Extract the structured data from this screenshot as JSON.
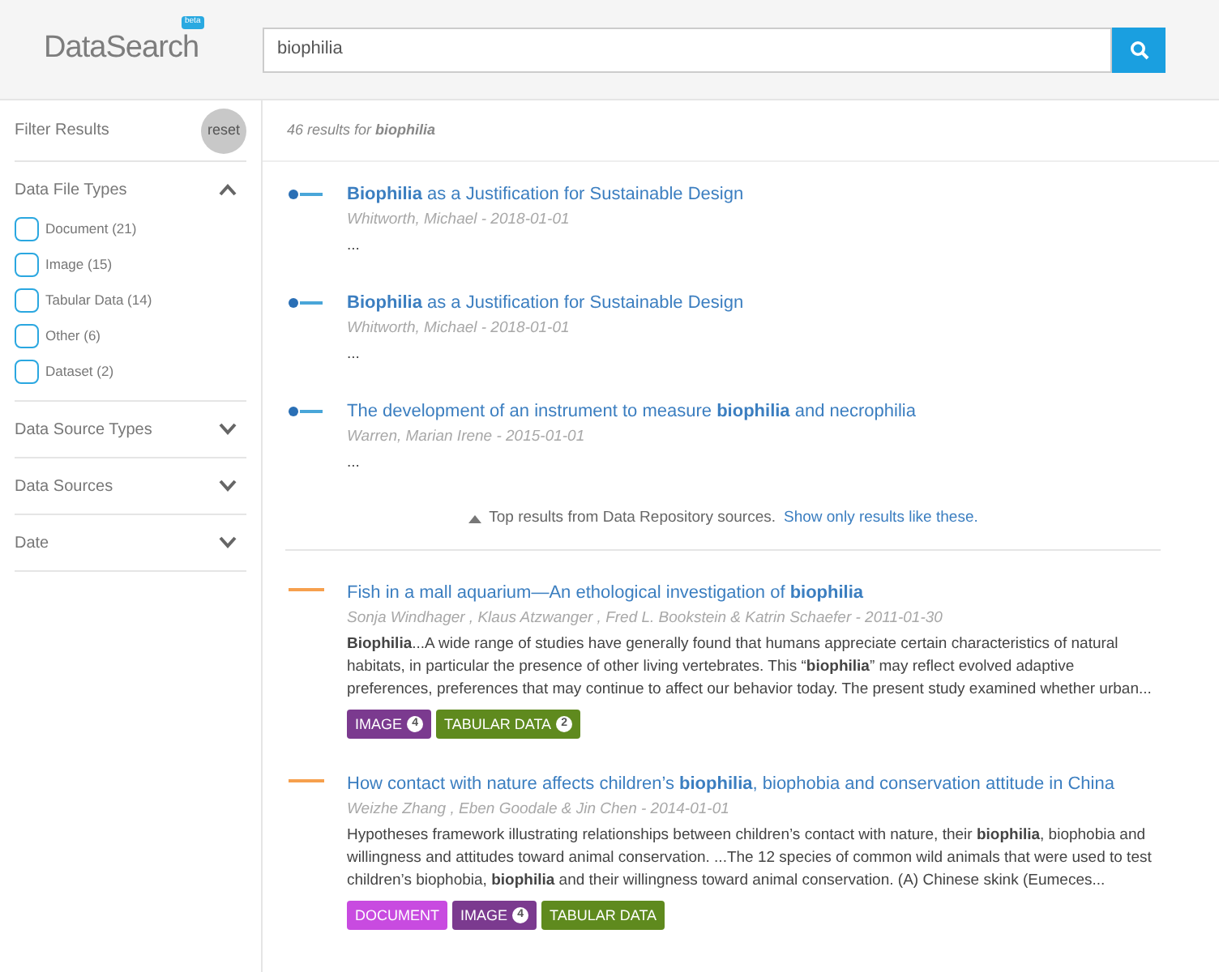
{
  "header": {
    "logo": "DataSearch",
    "logo_badge": "beta",
    "search": {
      "value": "biophilia"
    }
  },
  "sidebar": {
    "title": "Filter Results",
    "reset": "reset",
    "sections": [
      {
        "label": "Data File Types",
        "expanded": true,
        "options": [
          {
            "label": "Document (21)",
            "checked": false
          },
          {
            "label": "Image (15)",
            "checked": false
          },
          {
            "label": "Tabular Data (14)",
            "checked": false
          },
          {
            "label": "Other (6)",
            "checked": false
          },
          {
            "label": "Dataset (2)",
            "checked": false
          }
        ]
      },
      {
        "label": "Data Source Types",
        "expanded": false
      },
      {
        "label": "Data Sources",
        "expanded": false
      },
      {
        "label": "Date",
        "expanded": false
      }
    ]
  },
  "results_summary": "46 results for **biophilia**",
  "repository_results": [
    {
      "kind": "repository",
      "title": "**Biophilia** as a Justification for Sustainable Design",
      "meta": "Whitworth, Michael - 2018-01-01",
      "snippet": "..."
    },
    {
      "kind": "repository",
      "title": "**Biophilia** as a Justification for Sustainable Design",
      "meta": "Whitworth, Michael - 2018-01-01",
      "snippet": "..."
    },
    {
      "kind": "repository",
      "title": "The development of an instrument to measure **biophilia** and necrophilia",
      "meta": "Warren, Marian Irene - 2015-01-01",
      "snippet": "..."
    }
  ],
  "repository_note": {
    "text": "Top results from Data Repository sources.",
    "link": "Show only results like these."
  },
  "article_results": [
    {
      "kind": "article",
      "title": "Fish in a mall aquarium—An ethological investigation of **biophilia**",
      "meta": "Sonja Windhager , Klaus Atzwanger , Fred L. Bookstein & Katrin Schaefer - 2011-01-30",
      "snippet": "**Biophilia**...A wide range of studies have generally found that humans appreciate certain characteristics of natural habitats, in particular the presence of other living vertebrates. This “**biophilia**” may reflect evolved adaptive preferences, preferences that may continue to affect our behavior today. The present study examined whether urban...",
      "tags": [
        {
          "kind": "image",
          "label": "IMAGE",
          "count": "4"
        },
        {
          "kind": "tabular",
          "label": "TABULAR DATA",
          "count": "2"
        }
      ]
    },
    {
      "kind": "article",
      "title": "How contact with nature affects children’s **biophilia**, biophobia and conservation attitude in China",
      "meta": "Weizhe Zhang , Eben Goodale & Jin Chen - 2014-01-01",
      "snippet": "Hypotheses framework illustrating relationships between children’s contact with nature, their **biophilia**, biophobia and willingness and attitudes toward animal conservation. ...The 12 species of common wild animals that were used to test children’s biophobia, **biophilia** and their willingness toward animal conservation. (A) Chinese skink (Eumeces...",
      "tags": [
        {
          "kind": "document",
          "label": "DOCUMENT"
        },
        {
          "kind": "image",
          "label": "IMAGE",
          "count": "4"
        },
        {
          "kind": "tabular",
          "label": "TABULAR DATA"
        }
      ]
    }
  ]
}
